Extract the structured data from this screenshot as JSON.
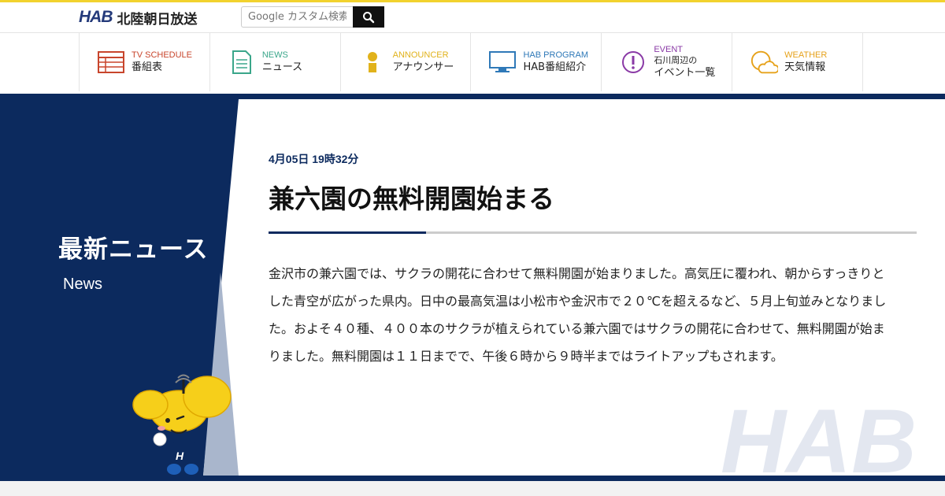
{
  "header": {
    "logo_mark": "HAB",
    "logo_text": "北陸朝日放送",
    "search_placeholder": "Google カスタム検索"
  },
  "nav": {
    "items": [
      {
        "en": "TV SCHEDULE",
        "jp": "番組表",
        "color": "#c8452c",
        "icon": "tv-schedule-icon"
      },
      {
        "en": "NEWS",
        "jp": "ニュース",
        "color": "#3aa68a",
        "icon": "news-document-icon"
      },
      {
        "en": "ANNOUNCER",
        "jp": "アナウンサー",
        "color": "#e1b21b",
        "icon": "announcer-person-icon"
      },
      {
        "en": "HAB PROGRAM",
        "jp": "HAB番組紹介",
        "color": "#2f79b8",
        "icon": "tv-monitor-icon"
      },
      {
        "en": "EVENT",
        "jp1": "石川周辺の",
        "jp2": "イベント一覧",
        "color": "#8a3aa6",
        "icon": "event-exclamation-icon"
      },
      {
        "en": "WEATHER",
        "jp": "天気情報",
        "color": "#e6a21b",
        "icon": "weather-cloud-sun-icon"
      }
    ]
  },
  "section": {
    "title": "最新ニュース",
    "subtitle": "News"
  },
  "article": {
    "date": "4月05日 19時32分",
    "title": "兼六園の無料開園始まる",
    "body": "金沢市の兼六園では、サクラの開花に合わせて無料開園が始まりました。高気圧に覆われ、朝からすっきりとした青空が広がった県内。日中の最高気温は小松市や金沢市で２０℃を超えるなど、５月上旬並みとなりました。およそ４０種、４００本のサクラが植えられている兼六園ではサクラの開花に合わせて、無料開園が始まりました。無料開園は１１日までで、午後６時から９時半まではライトアップもされます。"
  },
  "watermark": "HAB",
  "colors": {
    "navy": "#0c2a5e",
    "yellow": "#f2d22e"
  }
}
